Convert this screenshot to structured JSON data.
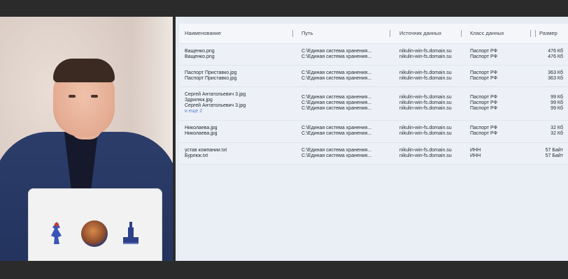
{
  "table": {
    "headers": {
      "name": "Наименование",
      "path": "Путь",
      "source": "Источник данных",
      "class": "Класс данных",
      "size": "Размер"
    },
    "rows": [
      {
        "names": [
          "Ващенко.png",
          "Ващенко.png"
        ],
        "paths": [
          "C:\\Единая система хранения...",
          "C:\\Единая система хранения..."
        ],
        "sources": [
          "nikulin-win-fs.domain.su",
          "nikulin-win-fs.domain.su"
        ],
        "classes": [
          "Паспорт РФ",
          "Паспорт РФ"
        ],
        "sizes": [
          "476 Кб",
          "476 Кб"
        ]
      },
      {
        "names": [
          "Паспорт Приставко.jpg",
          "Паспорт Приставко.jpg"
        ],
        "paths": [
          "C:\\Единая система хранения...",
          "C:\\Единая система хранения..."
        ],
        "sources": [
          "nikulin-win-fs.domain.su",
          "nikulin-win-fs.domain.su"
        ],
        "classes": [
          "Паспорт РФ",
          "Паспорт РФ"
        ],
        "sizes": [
          "363 Кб",
          "363 Кб"
        ]
      },
      {
        "names": [
          "Сергей Антатольевич 3.jpg",
          "Здрилюк.jpg",
          "Сергей Антатольевич 3.jpg"
        ],
        "more": "и еще 2",
        "paths": [
          "C:\\Единая система хранения...",
          "C:\\Единая система хранения...",
          "C:\\Единая система хранения..."
        ],
        "sources": [
          "nikulin-win-fs.domain.su",
          "nikulin-win-fs.domain.su",
          "nikulin-win-fs.domain.su"
        ],
        "classes": [
          "Паспорт РФ",
          "Паспорт РФ",
          "Паспорт РФ"
        ],
        "sizes": [
          "99 Кб",
          "99 Кб",
          "99 Кб"
        ]
      },
      {
        "names": [
          "Николаева.jpg",
          "Николаева.jpg"
        ],
        "paths": [
          "C:\\Единая система хранения...",
          "C:\\Единая система хранения..."
        ],
        "sources": [
          "nikulin-win-fs.domain.su",
          "nikulin-win-fs.domain.su"
        ],
        "classes": [
          "Паспорт РФ",
          "Паспорт РФ"
        ],
        "sizes": [
          "32 Кб",
          "32 Кб"
        ]
      },
      {
        "names": [
          "устав компании.txt",
          "Бурлюк.txt"
        ],
        "paths": [
          "C:\\Единая система хранения...",
          "C:\\Единая система хранения..."
        ],
        "sources": [
          "nikulin-win-fs.domain.su",
          "nikulin-win-fs.domain.su"
        ],
        "classes": [
          "ИНН",
          "ИНН"
        ],
        "sizes": [
          "57 Байт",
          "57 Байт"
        ]
      }
    ]
  }
}
